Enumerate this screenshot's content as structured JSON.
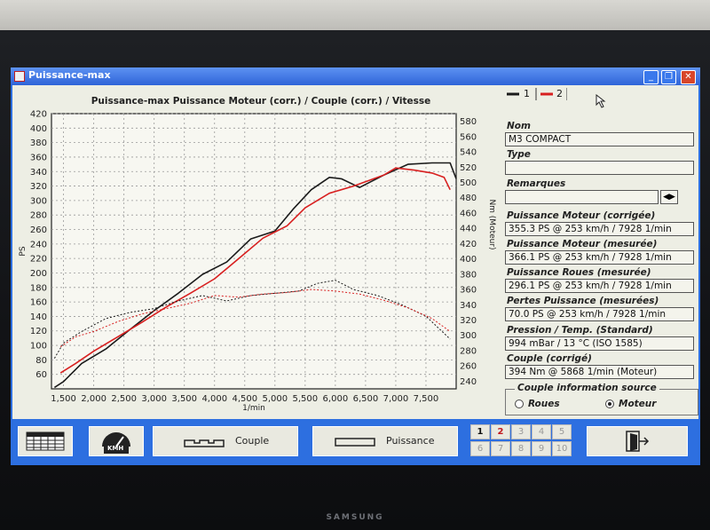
{
  "window": {
    "title": "Puissance-max",
    "controls": [
      "_",
      "❐",
      "✕"
    ]
  },
  "chart_data": {
    "type": "line",
    "title": "Puissance-max Puissance Moteur (corr.) / Couple (corr.) / Vitesse",
    "xlabel": "1/min",
    "ylabel_left": "PS",
    "ylabel_right": "Nm (Moteur)",
    "xlim": [
      1300,
      8000
    ],
    "ylim_left": [
      40,
      420
    ],
    "ylim_right": [
      230,
      590
    ],
    "x_ticks": [
      "1,500",
      "2,000",
      "2,500",
      "3,000",
      "3,500",
      "4,000",
      "4,500",
      "5,000",
      "5,500",
      "6,000",
      "6,500",
      "7,000",
      "7,500"
    ],
    "y_ticks_left": [
      "60",
      "80",
      "100",
      "120",
      "140",
      "160",
      "180",
      "200",
      "220",
      "240",
      "260",
      "280",
      "300",
      "320",
      "340",
      "360",
      "380",
      "400",
      "420"
    ],
    "y_ticks_right": [
      "240",
      "260",
      "280",
      "300",
      "320",
      "340",
      "360",
      "380",
      "400",
      "420",
      "440",
      "460",
      "480",
      "500",
      "520",
      "540",
      "560",
      "580"
    ],
    "grid": true,
    "series": [
      {
        "name": "1",
        "color": "#1b1b1b",
        "kind": "power",
        "x": [
          1350,
          1500,
          1800,
          2200,
          2600,
          3000,
          3400,
          3800,
          4200,
          4600,
          5000,
          5300,
          5600,
          5900,
          6100,
          6400,
          6800,
          7200,
          7600,
          7900,
          8000
        ],
        "y": [
          42,
          50,
          75,
          95,
          122,
          148,
          172,
          198,
          215,
          247,
          258,
          288,
          315,
          332,
          330,
          318,
          335,
          350,
          352,
          352,
          330
        ]
      },
      {
        "name": "2",
        "color": "#d82020",
        "kind": "power",
        "x": [
          1450,
          1700,
          2000,
          2400,
          2800,
          3200,
          3600,
          4000,
          4400,
          4800,
          5200,
          5500,
          5900,
          6300,
          6800,
          7000,
          7300,
          7600,
          7800,
          7900
        ],
        "y": [
          62,
          75,
          92,
          112,
          132,
          153,
          172,
          192,
          220,
          248,
          265,
          290,
          310,
          320,
          335,
          345,
          342,
          338,
          332,
          315
        ]
      },
      {
        "name": "1",
        "color": "#1b1b1b",
        "kind": "torque",
        "x": [
          1350,
          1500,
          1800,
          2200,
          2600,
          3000,
          3400,
          3800,
          4200,
          4600,
          5000,
          5400,
          5700,
          6000,
          6300,
          6700,
          7100,
          7500,
          7900
        ],
        "y": [
          270,
          290,
          305,
          322,
          330,
          335,
          345,
          352,
          345,
          352,
          355,
          358,
          368,
          372,
          360,
          352,
          340,
          325,
          295
        ]
      },
      {
        "name": "2",
        "color": "#d82020",
        "kind": "torque",
        "x": [
          1450,
          1700,
          2000,
          2400,
          2800,
          3200,
          3600,
          4000,
          4400,
          4800,
          5200,
          5600,
          6000,
          6400,
          6800,
          7200,
          7600,
          7900
        ],
        "y": [
          285,
          298,
          305,
          318,
          328,
          335,
          342,
          352,
          350,
          354,
          356,
          360,
          358,
          354,
          346,
          336,
          322,
          305
        ]
      }
    ]
  },
  "panel": {
    "legend": {
      "series1": "1",
      "series2": "2"
    },
    "nom": {
      "label": "Nom",
      "value": "M3 COMPACT"
    },
    "type": {
      "label": "Type",
      "value": ""
    },
    "remarques": {
      "label": "Remarques",
      "value": ""
    },
    "puissance_moteur_corr": {
      "label": "Puissance Moteur (corrigée)",
      "value": "355.3 PS @ 253 km/h / 7928 1/min"
    },
    "puissance_moteur_mes": {
      "label": "Puissance Moteur (mesurée)",
      "value": "366.1 PS @ 253 km/h / 7928 1/min"
    },
    "puissance_roues": {
      "label": "Puissance Roues (mesurée)",
      "value": "296.1 PS @ 253 km/h / 7928 1/min"
    },
    "pertes": {
      "label": "Pertes Puissance (mesurées)",
      "value": "70.0 PS @ 253 km/h / 7928 1/min"
    },
    "pression": {
      "label": "Pression / Temp. (Standard)",
      "value": "994 mBar / 13 °C (ISO 1585)"
    },
    "couple": {
      "label": "Couple (corrigé)",
      "value": "394 Nm @ 5868 1/min (Moteur)"
    },
    "couple_source": {
      "title": "Couple information source",
      "opt1": "Roues",
      "opt2": "Moteur",
      "selected": "Moteur"
    }
  },
  "bottom": {
    "kmh_label": "KMH",
    "couple_label": "Couple",
    "puissance_label": "Puissance",
    "numbers": [
      "1",
      "2",
      "3",
      "4",
      "5",
      "6",
      "7",
      "8",
      "9",
      "10"
    ]
  }
}
